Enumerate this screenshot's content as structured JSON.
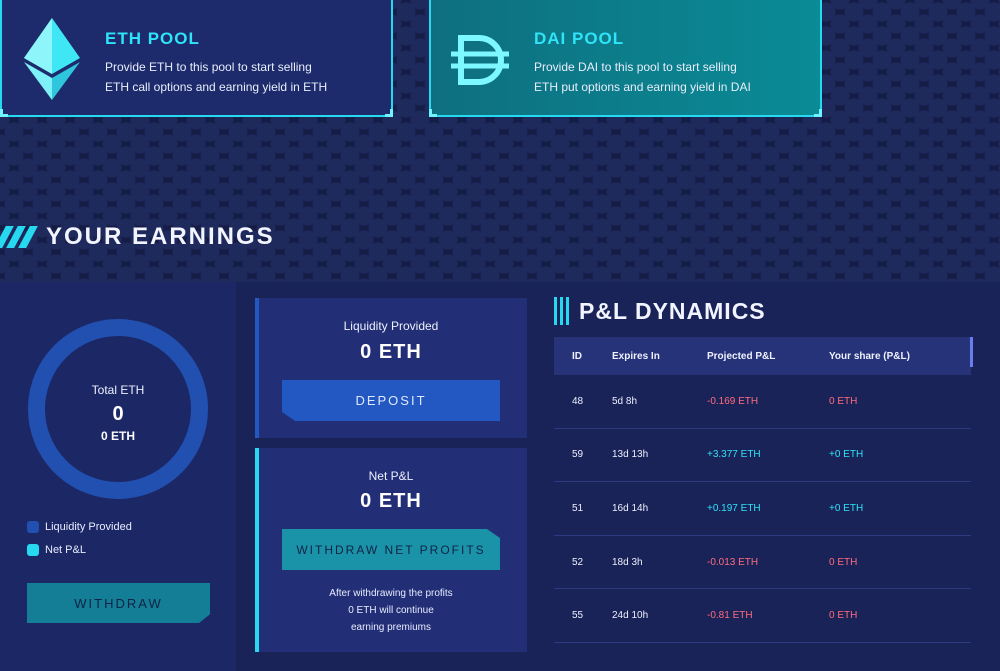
{
  "pools": {
    "eth": {
      "title": "ETH POOL",
      "line1": "Provide ETH to this pool to start selling",
      "line2": "ETH call options and earning yield in ETH"
    },
    "dai": {
      "title": "DAI POOL",
      "line1": "Provide DAI to this pool to start selling",
      "line2": "ETH put options and earning yield in DAI"
    }
  },
  "earnings": {
    "title": "YOUR EARNINGS",
    "donut": {
      "label": "Total ETH",
      "value": "0",
      "sub": "0 ETH"
    },
    "legend": [
      {
        "label": "Liquidity Provided",
        "color": "#2150b0"
      },
      {
        "label": "Net P&L",
        "color": "#27d9f0"
      }
    ],
    "withdraw_label": "WITHDRAW",
    "liquidity": {
      "label": "Liquidity Provided",
      "value": "0 ETH",
      "button": "DEPOSIT"
    },
    "netpl": {
      "label": "Net P&L",
      "value": "0 ETH",
      "button": "WITHDRAW NET PROFITS",
      "note1": "After withdrawing the profits",
      "note2": "0 ETH will continue",
      "note3": "earning premiums"
    }
  },
  "pl_dynamics": {
    "title": "P&L DYNAMICS",
    "headers": {
      "id": "ID",
      "expires": "Expires In",
      "projected": "Projected P&L",
      "share": "Your share (P&L)"
    },
    "rows": [
      {
        "id": "48",
        "expires": "5d 8h",
        "projected": "-0.169 ETH",
        "share": "0 ETH",
        "sign": "neg"
      },
      {
        "id": "59",
        "expires": "13d 13h",
        "projected": "+3.377 ETH",
        "share": "+0 ETH",
        "sign": "pos"
      },
      {
        "id": "51",
        "expires": "16d 14h",
        "projected": "+0.197 ETH",
        "share": "+0 ETH",
        "sign": "pos"
      },
      {
        "id": "52",
        "expires": "18d 3h",
        "projected": "-0.013 ETH",
        "share": "0 ETH",
        "sign": "neg"
      },
      {
        "id": "55",
        "expires": "24d 10h",
        "projected": "-0.81 ETH",
        "share": "0 ETH",
        "sign": "neg"
      }
    ]
  }
}
